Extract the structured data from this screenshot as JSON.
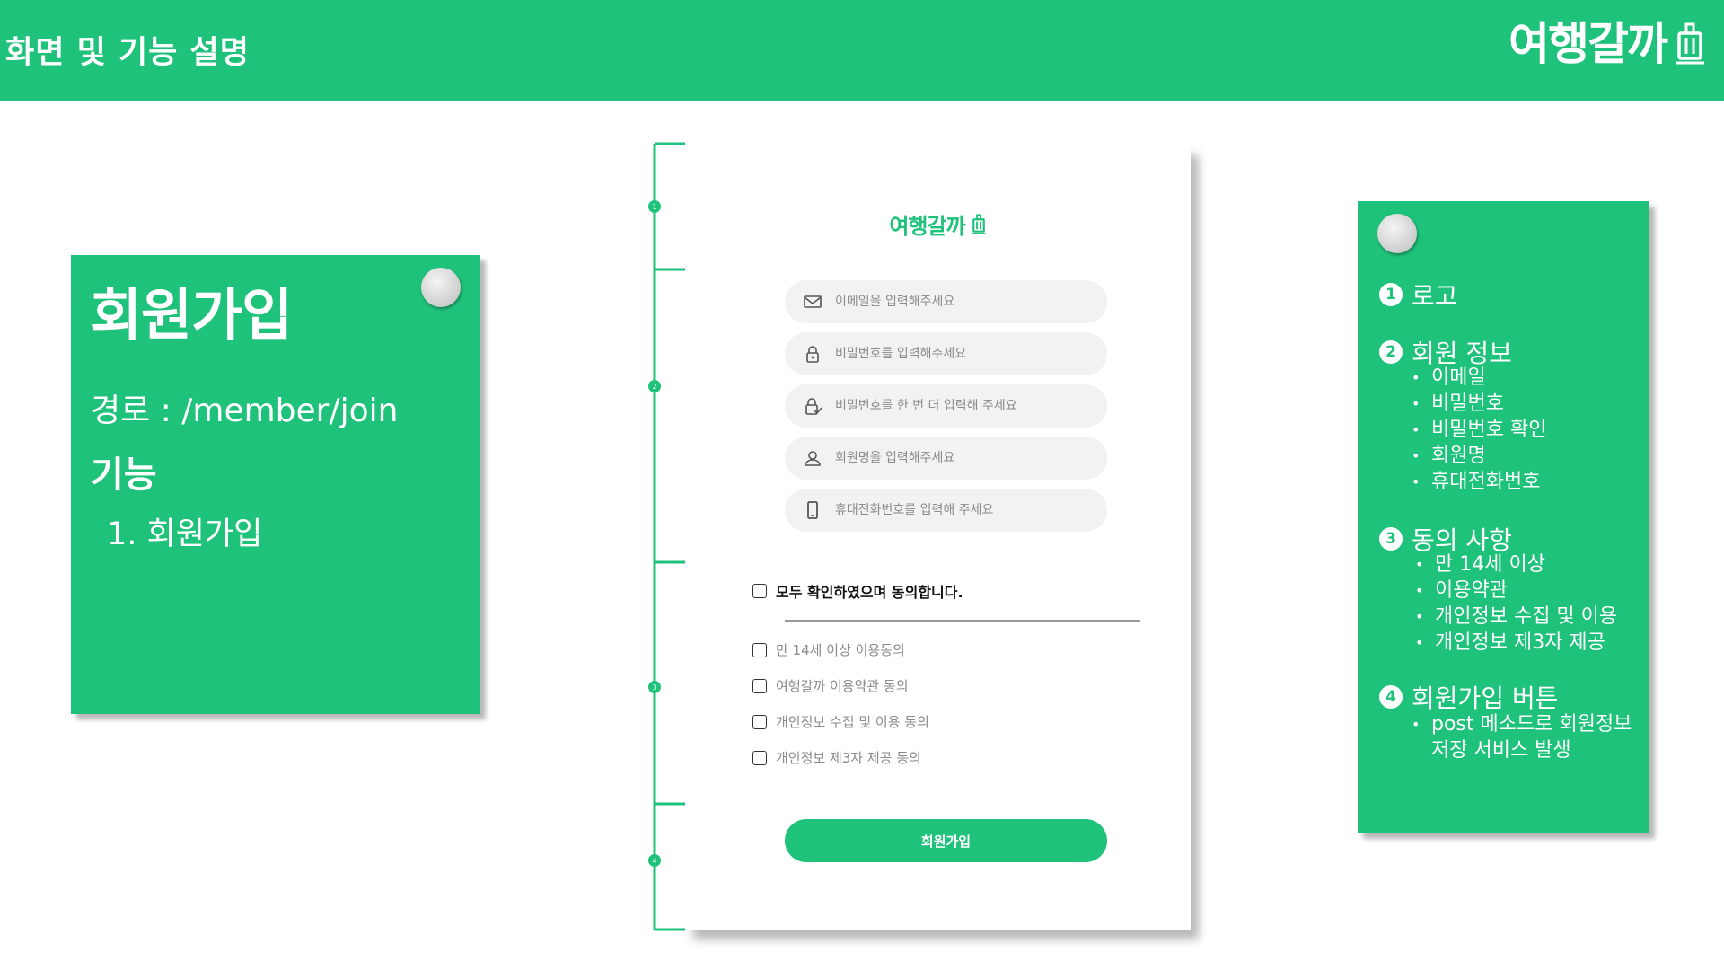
{
  "header": {
    "title": "화면 및 기능 설명",
    "brand": "여행갈까"
  },
  "note_left": {
    "title": "회원가입",
    "path": "경로 : /member/join",
    "function_heading": "기능",
    "function_item": "1. 회원가입"
  },
  "timeline": {
    "markers": [
      "1",
      "2",
      "3",
      "4"
    ]
  },
  "form": {
    "logo": "여행갈까",
    "fields": [
      {
        "icon": "mail-icon",
        "placeholder": "이메일을 입력해주세요"
      },
      {
        "icon": "lock-icon",
        "placeholder": "비밀번호를 입력해주세요"
      },
      {
        "icon": "lock-check-icon",
        "placeholder": "비밀번호를 한 번 더 입력해 주세요"
      },
      {
        "icon": "user-icon",
        "placeholder": "회원명을 입력해주세요"
      },
      {
        "icon": "phone-icon",
        "placeholder": "휴대전화번호를 입력해 주세요"
      }
    ],
    "agree_all": "모두 확인하였으며 동의합니다.",
    "agreements": [
      "만 14세 이상 이용동의",
      "여행갈까 이용약관 동의",
      "개인정보 수집 및 이용 동의",
      "개인정보 제3자 제공 동의"
    ],
    "submit_label": "회원가입"
  },
  "note_right": {
    "sections": [
      {
        "num": "1",
        "title": "로고",
        "items": []
      },
      {
        "num": "2",
        "title": "회원 정보",
        "items": [
          "이메일",
          "비밀번호",
          "비밀번호 확인",
          "회원명",
          "휴대전화번호"
        ]
      },
      {
        "num": "3",
        "title": "동의 사항",
        "items": [
          "만 14세 이상",
          "이용약관",
          "개인정보 수집 및 이용",
          "개인정보 제3자 제공"
        ]
      },
      {
        "num": "4",
        "title": "회원가입 버튼",
        "items": [
          "post 메소드로 회원정보 저장 서비스 발생"
        ]
      }
    ]
  },
  "colors": {
    "brand_green": "#1fc27a",
    "field_bg": "#f2f2f2",
    "placeholder_gray": "#8a8a8a"
  }
}
